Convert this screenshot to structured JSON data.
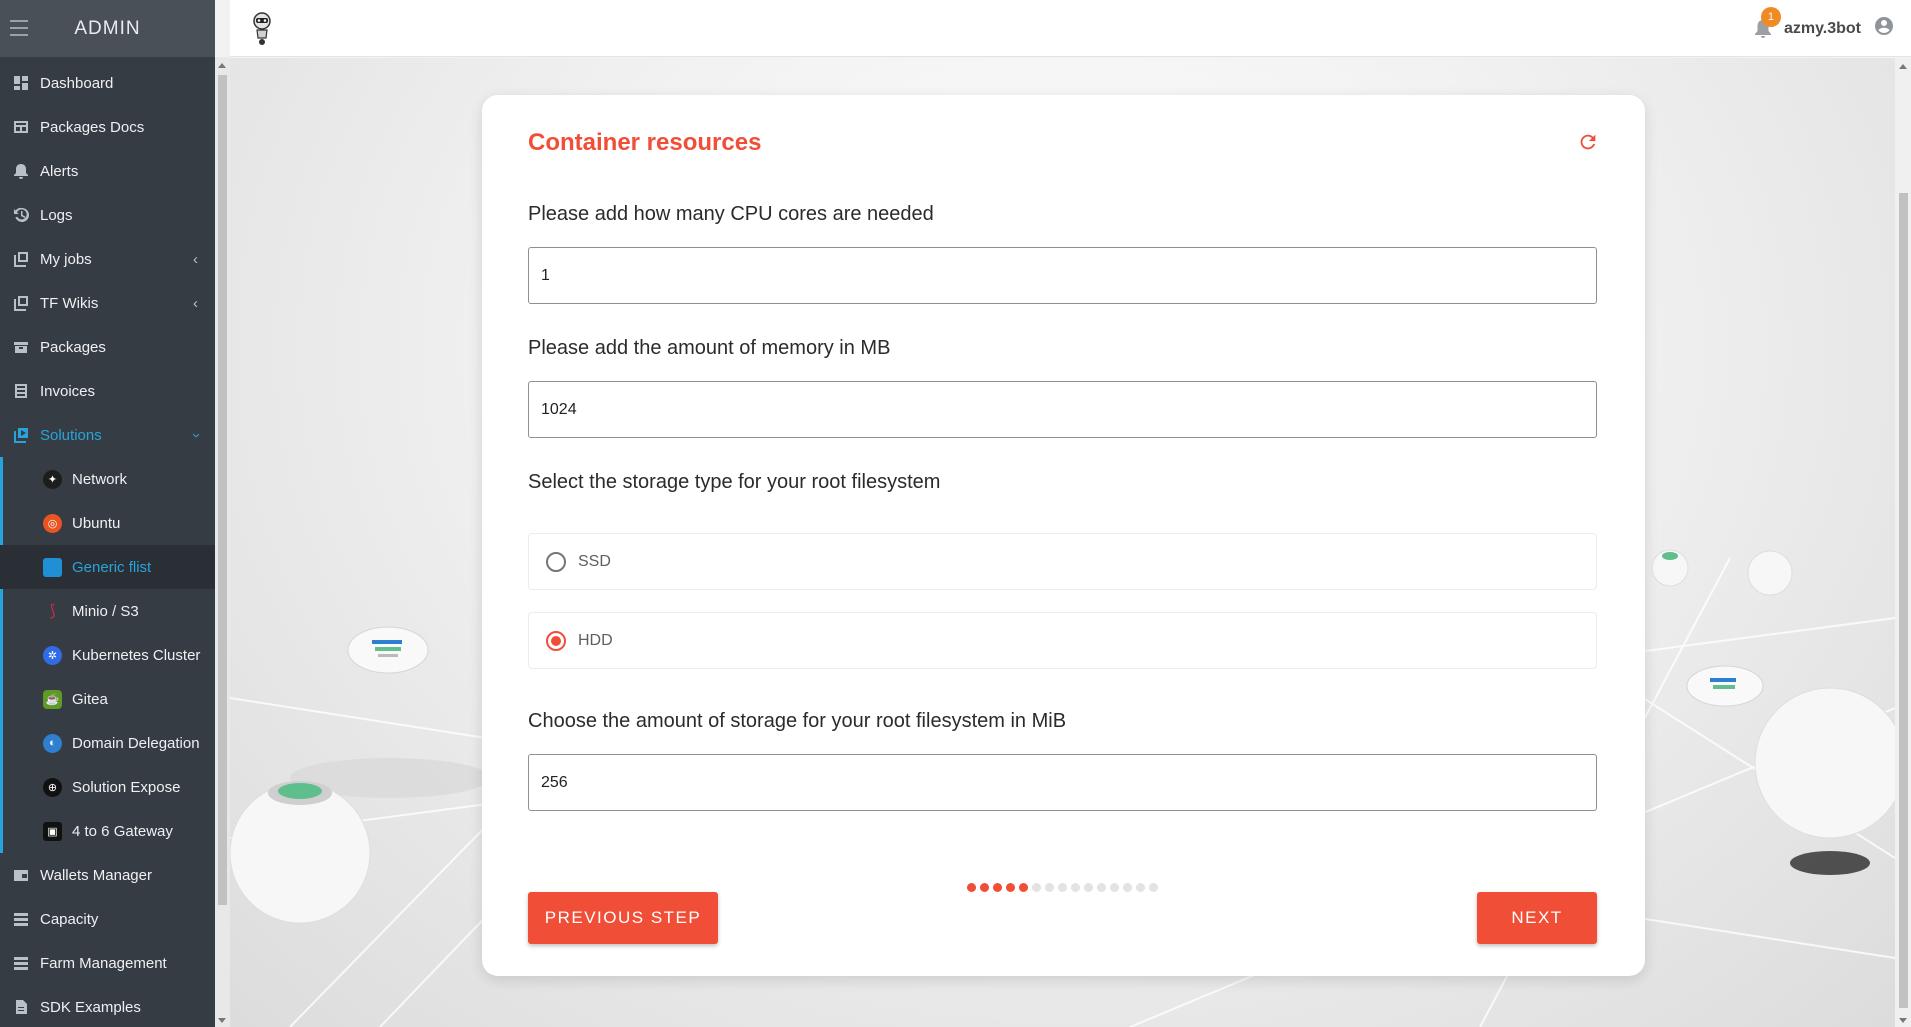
{
  "sidebar": {
    "brand": "ADMIN",
    "items": [
      {
        "label": "Dashboard",
        "icon": "dashboard-icon"
      },
      {
        "label": "Packages Docs",
        "icon": "docs-icon"
      },
      {
        "label": "Alerts",
        "icon": "bell-icon"
      },
      {
        "label": "Logs",
        "icon": "history-icon"
      },
      {
        "label": "My jobs",
        "icon": "jobs-icon"
      },
      {
        "label": "TF Wikis",
        "icon": "wiki-icon"
      },
      {
        "label": "Packages",
        "icon": "package-icon"
      },
      {
        "label": "Invoices",
        "icon": "invoice-icon"
      },
      {
        "label": "Solutions",
        "icon": "solutions-icon"
      }
    ],
    "solutions": [
      {
        "label": "Network",
        "icon": "network-icon"
      },
      {
        "label": "Ubuntu",
        "icon": "ubuntu-icon"
      },
      {
        "label": "Generic flist",
        "icon": "flist-icon"
      },
      {
        "label": "Minio / S3",
        "icon": "minio-icon"
      },
      {
        "label": "Kubernetes Cluster",
        "icon": "kubernetes-icon"
      },
      {
        "label": "Gitea",
        "icon": "gitea-icon"
      },
      {
        "label": "Domain Delegation",
        "icon": "domain-icon"
      },
      {
        "label": "Solution Expose",
        "icon": "globe-icon"
      },
      {
        "label": "4 to 6 Gateway",
        "icon": "gateway-icon"
      }
    ],
    "bottom_items": [
      {
        "label": "Wallets Manager",
        "icon": "wallet-icon"
      },
      {
        "label": "Capacity",
        "icon": "capacity-icon"
      },
      {
        "label": "Farm Management",
        "icon": "farm-icon"
      },
      {
        "label": "SDK Examples",
        "icon": "sdk-icon"
      }
    ]
  },
  "topbar": {
    "notification_count": "1",
    "username": "azmy.3bot"
  },
  "form": {
    "title": "Container resources",
    "cpu_label": "Please add how many CPU cores are needed",
    "cpu_value": "1",
    "memory_label": "Please add the amount of memory in MB",
    "memory_value": "1024",
    "storage_type_label": "Select the storage type for your root filesystem",
    "storage_options": [
      "SSD",
      "HDD"
    ],
    "storage_selected": "HDD",
    "disk_label": "Choose the amount of storage for your root filesystem in MiB",
    "disk_value": "256",
    "prev_button": "PREVIOUS STEP",
    "next_button": "NEXT",
    "steps_total": 15,
    "steps_done": 5
  },
  "colors": {
    "accent": "#f04e37",
    "sidebar_bg": "#363c44",
    "sidebar_active": "#29a3db"
  }
}
